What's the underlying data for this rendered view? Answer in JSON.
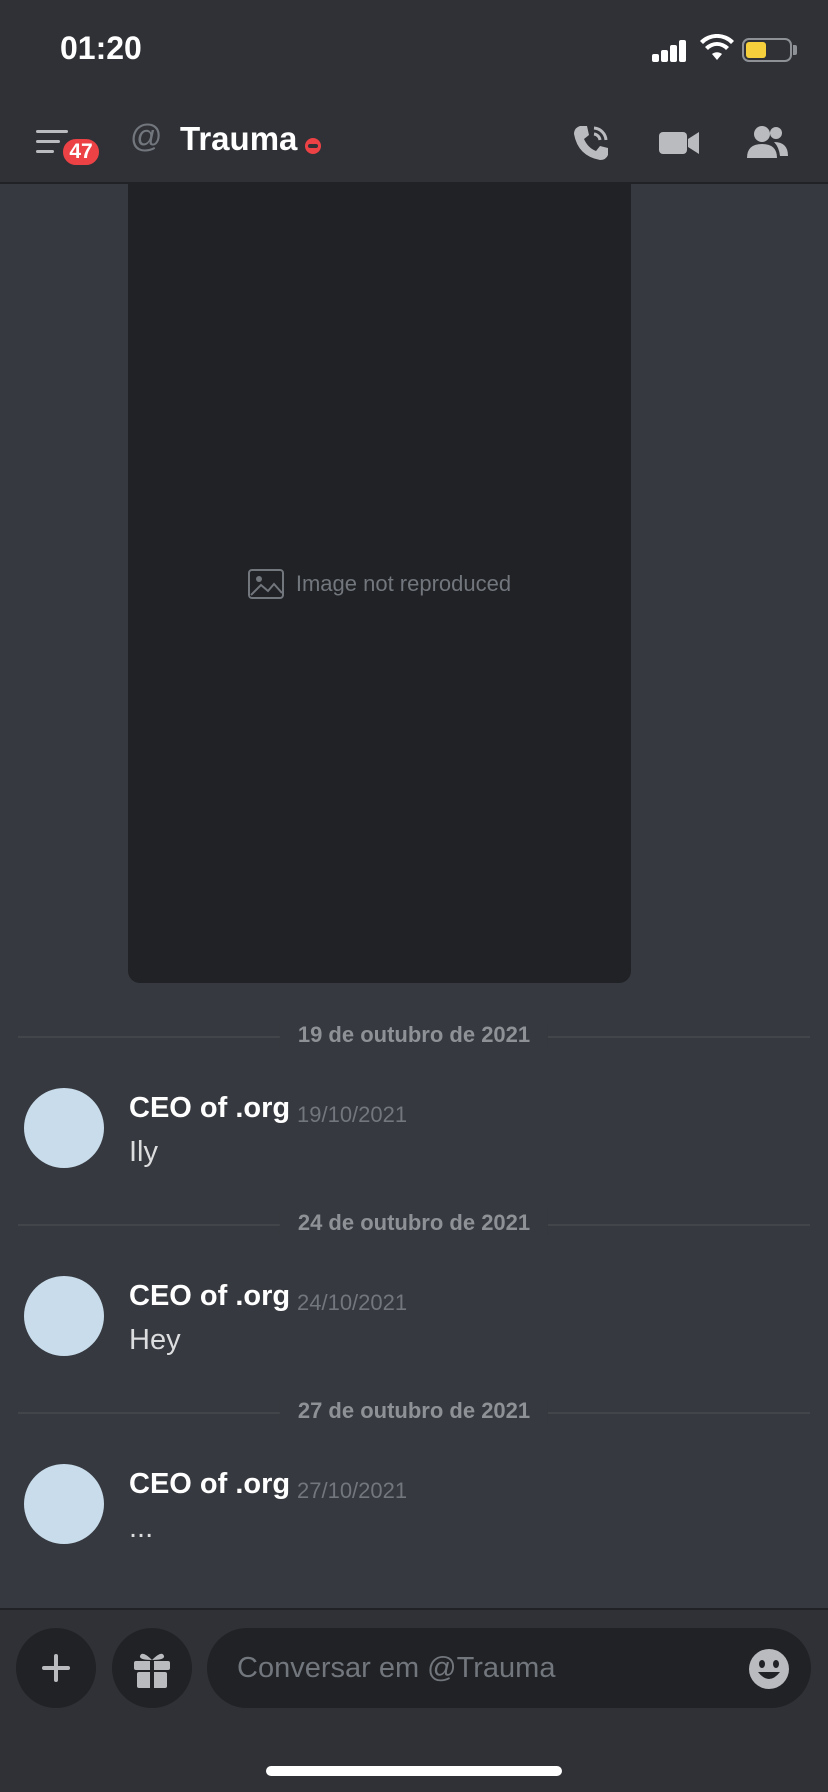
{
  "status_bar": {
    "time": "01:20"
  },
  "header": {
    "notification_count": "47",
    "channel_prefix": "@",
    "channel_name": "Trauma"
  },
  "attachment": {
    "placeholder": "Image not reproduced"
  },
  "messages": [
    {
      "date_divider": "19 de outubro de 2021",
      "author": "CEO of .org",
      "timestamp": "19/10/2021",
      "content": "Ily"
    },
    {
      "date_divider": "24 de outubro de 2021",
      "author": "CEO of .org",
      "timestamp": "24/10/2021",
      "content": "Hey"
    },
    {
      "date_divider": "27 de outubro de 2021",
      "author": "CEO of .org",
      "timestamp": "27/10/2021",
      "content": "..."
    }
  ],
  "composer": {
    "placeholder": "Conversar em @Trauma"
  },
  "colors": {
    "background": "#36393f",
    "header": "#2f3136",
    "badge": "#ed4245",
    "battery": "#f5d03c"
  }
}
